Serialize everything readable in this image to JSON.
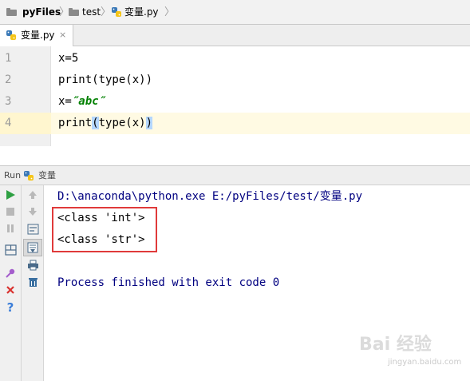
{
  "breadcrumb": {
    "project": "pyFiles",
    "folder": "test",
    "file": "变量.py",
    "separator": "〉"
  },
  "editor_tab": {
    "label": "变量.py",
    "close_glyph": "×"
  },
  "editor": {
    "lines": [
      {
        "number": "1",
        "text": "x=5"
      },
      {
        "number": "2",
        "text": "print(type(x))"
      },
      {
        "number": "3",
        "prefix": "x=",
        "string_literal": "″abc″"
      },
      {
        "number": "4",
        "pre": "print",
        "bracket_open": "(",
        "mid": "type(x)",
        "bracket_close": ")"
      }
    ],
    "string_color": "#008000",
    "current_line_number": "4"
  },
  "run_panel": {
    "label": "Run",
    "config_name": "变量"
  },
  "console": {
    "command": "D:\\anaconda\\python.exe E:/pyFiles/test/变量.py",
    "output": [
      "<class 'int'>",
      "<class 'str'>"
    ],
    "exit_message": "Process finished with exit code 0",
    "text_color": "#000080",
    "highlight_color": "#e03a3a"
  },
  "icons": {
    "toolbar_left": [
      "run-icon",
      "stop-icon",
      "pause-icon",
      "layout-icon",
      "pin-icon",
      "close-icon",
      "help-icon"
    ],
    "toolbar_right": [
      "up-arrow-icon",
      "down-arrow-icon",
      "soft-wrap-icon",
      "scroll-to-end-icon",
      "print-icon",
      "trash-icon"
    ]
  },
  "watermark": {
    "logo": "Bai 经验",
    "url": "jingyan.baidu.com"
  }
}
